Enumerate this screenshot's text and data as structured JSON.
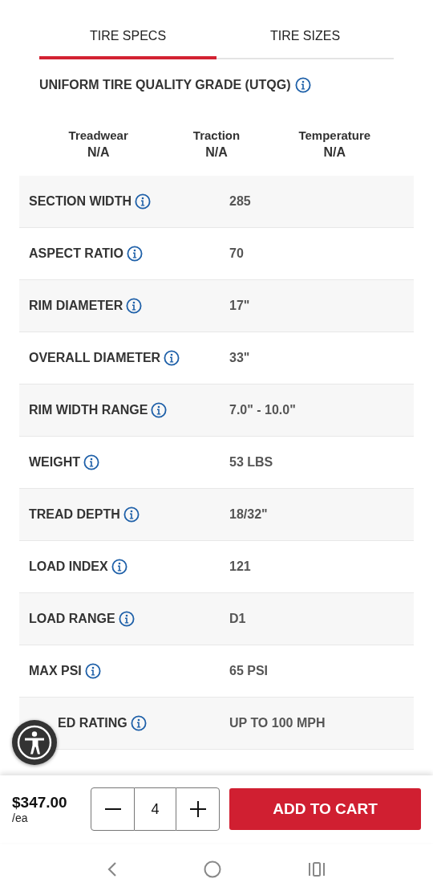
{
  "tabs": [
    {
      "label": "TIRE SPECS",
      "selected": true
    },
    {
      "label": "TIRE SIZES",
      "selected": false
    }
  ],
  "utqg": {
    "title": "UNIFORM TIRE QUALITY GRADE (UTQG)",
    "grades": [
      {
        "label": "Treadwear",
        "value": "N/A"
      },
      {
        "label": "Traction",
        "value": "N/A"
      },
      {
        "label": "Temperature",
        "value": "N/A"
      }
    ]
  },
  "specs": [
    {
      "label": "SECTION WIDTH",
      "value": "285",
      "obscured": false
    },
    {
      "label": "ASPECT RATIO",
      "value": "70",
      "obscured": false
    },
    {
      "label": "RIM DIAMETER",
      "value": "17\"",
      "obscured": false
    },
    {
      "label": "OVERALL DIAMETER",
      "value": "33\"",
      "obscured": false
    },
    {
      "label": "RIM WIDTH RANGE",
      "value": "7.0\" - 10.0\"",
      "obscured": false
    },
    {
      "label": "WEIGHT",
      "value": "53 LBS",
      "obscured": false
    },
    {
      "label": "TREAD DEPTH",
      "value": "18/32\"",
      "obscured": false
    },
    {
      "label": "LOAD INDEX",
      "value": "121",
      "obscured": false
    },
    {
      "label": "LOAD RANGE",
      "value": "D1",
      "obscured": false
    },
    {
      "label": "MAX PSI",
      "value": "65 PSI",
      "obscured": false
    },
    {
      "label": "ED RATING",
      "value": "UP TO 100 MPH",
      "obscured": true
    }
  ],
  "cart": {
    "price": "$347.00",
    "unit": "/ea",
    "quantity": "4",
    "button": "ADD TO CART"
  }
}
